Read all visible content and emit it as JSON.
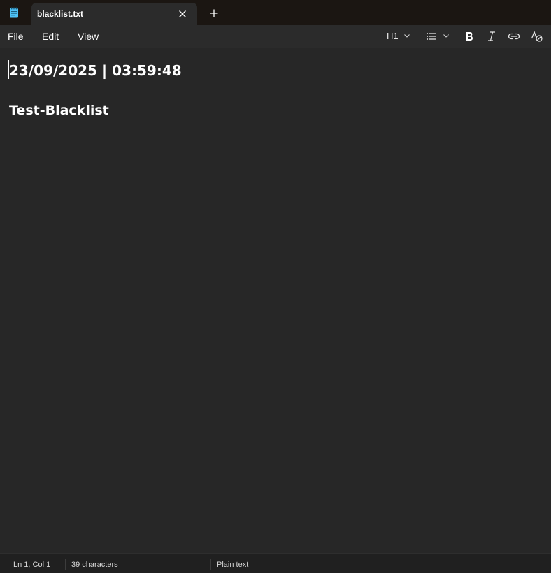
{
  "tab": {
    "title": "blacklist.txt",
    "close_icon": "close-icon",
    "new_tab_icon": "plus-icon"
  },
  "app_icon": "notepad-icon",
  "menu": {
    "file": "File",
    "edit": "Edit",
    "view": "View"
  },
  "format_toolbar": {
    "heading": "H1",
    "list_icon": "bulleted-list-icon",
    "bold_icon": "bold-icon",
    "italic_icon": "italic-icon",
    "link_icon": "link-icon",
    "clear_format_icon": "clear-formatting-icon"
  },
  "document": {
    "lines": [
      "23/09/2025 | 03:59:48",
      "Test-Blacklist"
    ]
  },
  "status": {
    "position": "Ln 1, Col 1",
    "characters": "39 characters",
    "format": "Plain text"
  },
  "colors": {
    "titlebar_bg": "#1b1612",
    "tab_bg": "#2b2b2b",
    "editor_bg": "#272727",
    "statusbar_bg": "#202020",
    "app_icon_accent": "#4fc3f7"
  }
}
